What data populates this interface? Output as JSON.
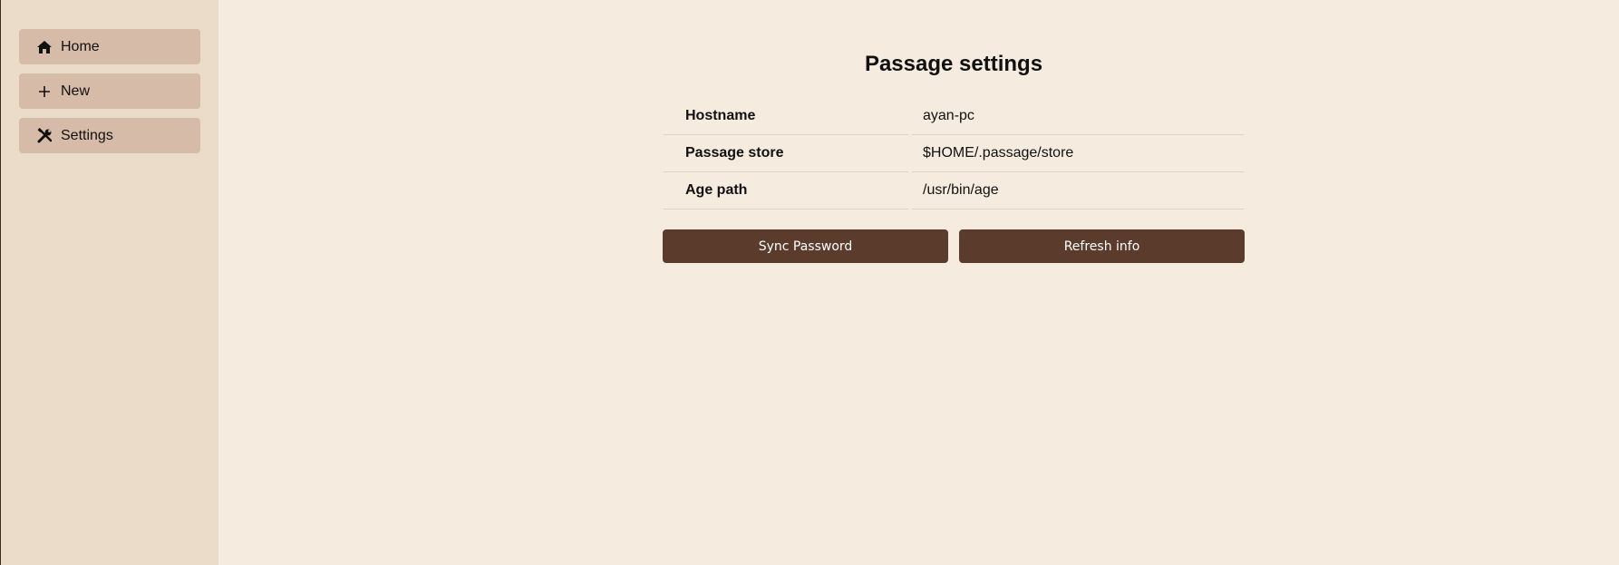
{
  "sidebar": {
    "items": [
      {
        "label": "Home",
        "icon": "home-icon"
      },
      {
        "label": "New",
        "icon": "plus-icon"
      },
      {
        "label": "Settings",
        "icon": "tools-icon"
      }
    ]
  },
  "main": {
    "title": "Passage settings",
    "rows": [
      {
        "key": "Hostname",
        "value": "ayan-pc"
      },
      {
        "key": "Passage store",
        "value": "$HOME/.passage/store"
      },
      {
        "key": "Age path",
        "value": "/usr/bin/age"
      }
    ],
    "buttons": {
      "sync_label": "Sync Password",
      "refresh_label": "Refresh info"
    }
  },
  "colors": {
    "sidebar_bg": "#ebdcc9",
    "nav_item_bg": "#d5bba8",
    "main_bg": "#f5ebdf",
    "button_bg": "#5b3b2c"
  }
}
